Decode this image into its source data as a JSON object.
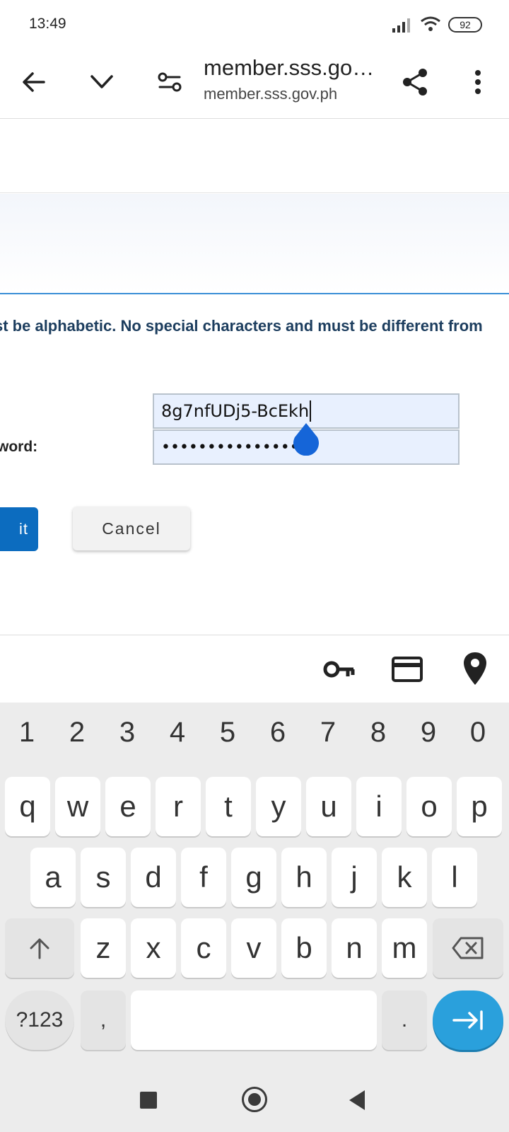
{
  "status_bar": {
    "time": "13:49",
    "battery": "92"
  },
  "browser": {
    "title": "member.sss.go…",
    "url": "member.sss.gov.ph"
  },
  "page": {
    "hint": "st be alphabetic. No special characters and must be different from",
    "confirm_label": "word:",
    "new_password_value": "8g7nfUDj5-BcEkh",
    "confirm_password_value": "•••••••••••••••",
    "submit_label": "it",
    "cancel_label": "Cancel"
  },
  "keyboard": {
    "numbers": [
      "1",
      "2",
      "3",
      "4",
      "5",
      "6",
      "7",
      "8",
      "9",
      "0"
    ],
    "row1": [
      "q",
      "w",
      "e",
      "r",
      "t",
      "y",
      "u",
      "i",
      "o",
      "p"
    ],
    "row2": [
      "a",
      "s",
      "d",
      "f",
      "g",
      "h",
      "j",
      "k",
      "l"
    ],
    "row3": [
      "z",
      "x",
      "c",
      "v",
      "b",
      "n",
      "m"
    ],
    "symbols_label": "?123",
    "comma": ",",
    "period": "."
  },
  "colors": {
    "accent_blue": "#0c6cbf",
    "autofill_bg": "#e8f0fe",
    "enter_key": "#2aa0dc",
    "hint_text": "#1c3d5e"
  }
}
